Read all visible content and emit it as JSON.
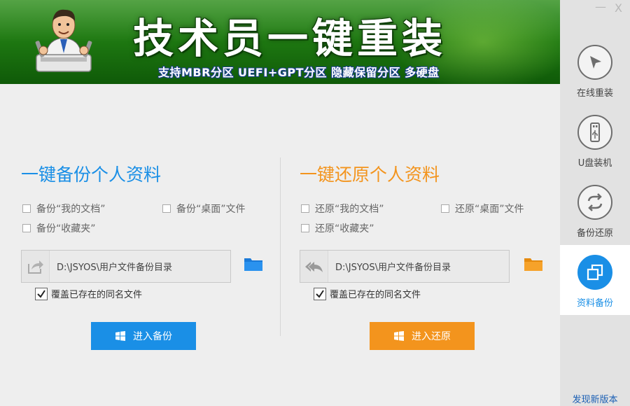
{
  "banner": {
    "title": "技术员一键重装",
    "subtitle": "支持MBR分区 UEFI+GPT分区 隐藏保留分区 多硬盘"
  },
  "window": {
    "minimize": "—",
    "close": "X"
  },
  "sidebar": {
    "items": [
      {
        "label": "在线重装",
        "icon": "cursor-icon"
      },
      {
        "label": "U盘装机",
        "icon": "usb-icon"
      },
      {
        "label": "备份还原",
        "icon": "sync-icon"
      },
      {
        "label": "资料备份",
        "icon": "copy-icon",
        "active": true
      }
    ],
    "new_version": "发现新版本"
  },
  "backup": {
    "title": "一键备份个人资料",
    "options": [
      "备份“我的文档”",
      "备份“桌面”文件",
      "备份“收藏夹”"
    ],
    "path": "D:\\JSYOS\\用户文件备份目录",
    "overwrite_label": "覆盖已存在的同名文件",
    "overwrite_checked": true,
    "button": "进入备份"
  },
  "restore": {
    "title": "一键还原个人资料",
    "options": [
      "还原“我的文档”",
      "还原“桌面”文件",
      "还原“收藏夹”"
    ],
    "path": "D:\\JSYOS\\用户文件备份目录",
    "overwrite_label": "覆盖已存在的同名文件",
    "overwrite_checked": true,
    "button": "进入还原"
  },
  "colors": {
    "backup_accent": "#1a8fe6",
    "restore_accent": "#f3941d",
    "banner_green": "#1f7a12"
  }
}
